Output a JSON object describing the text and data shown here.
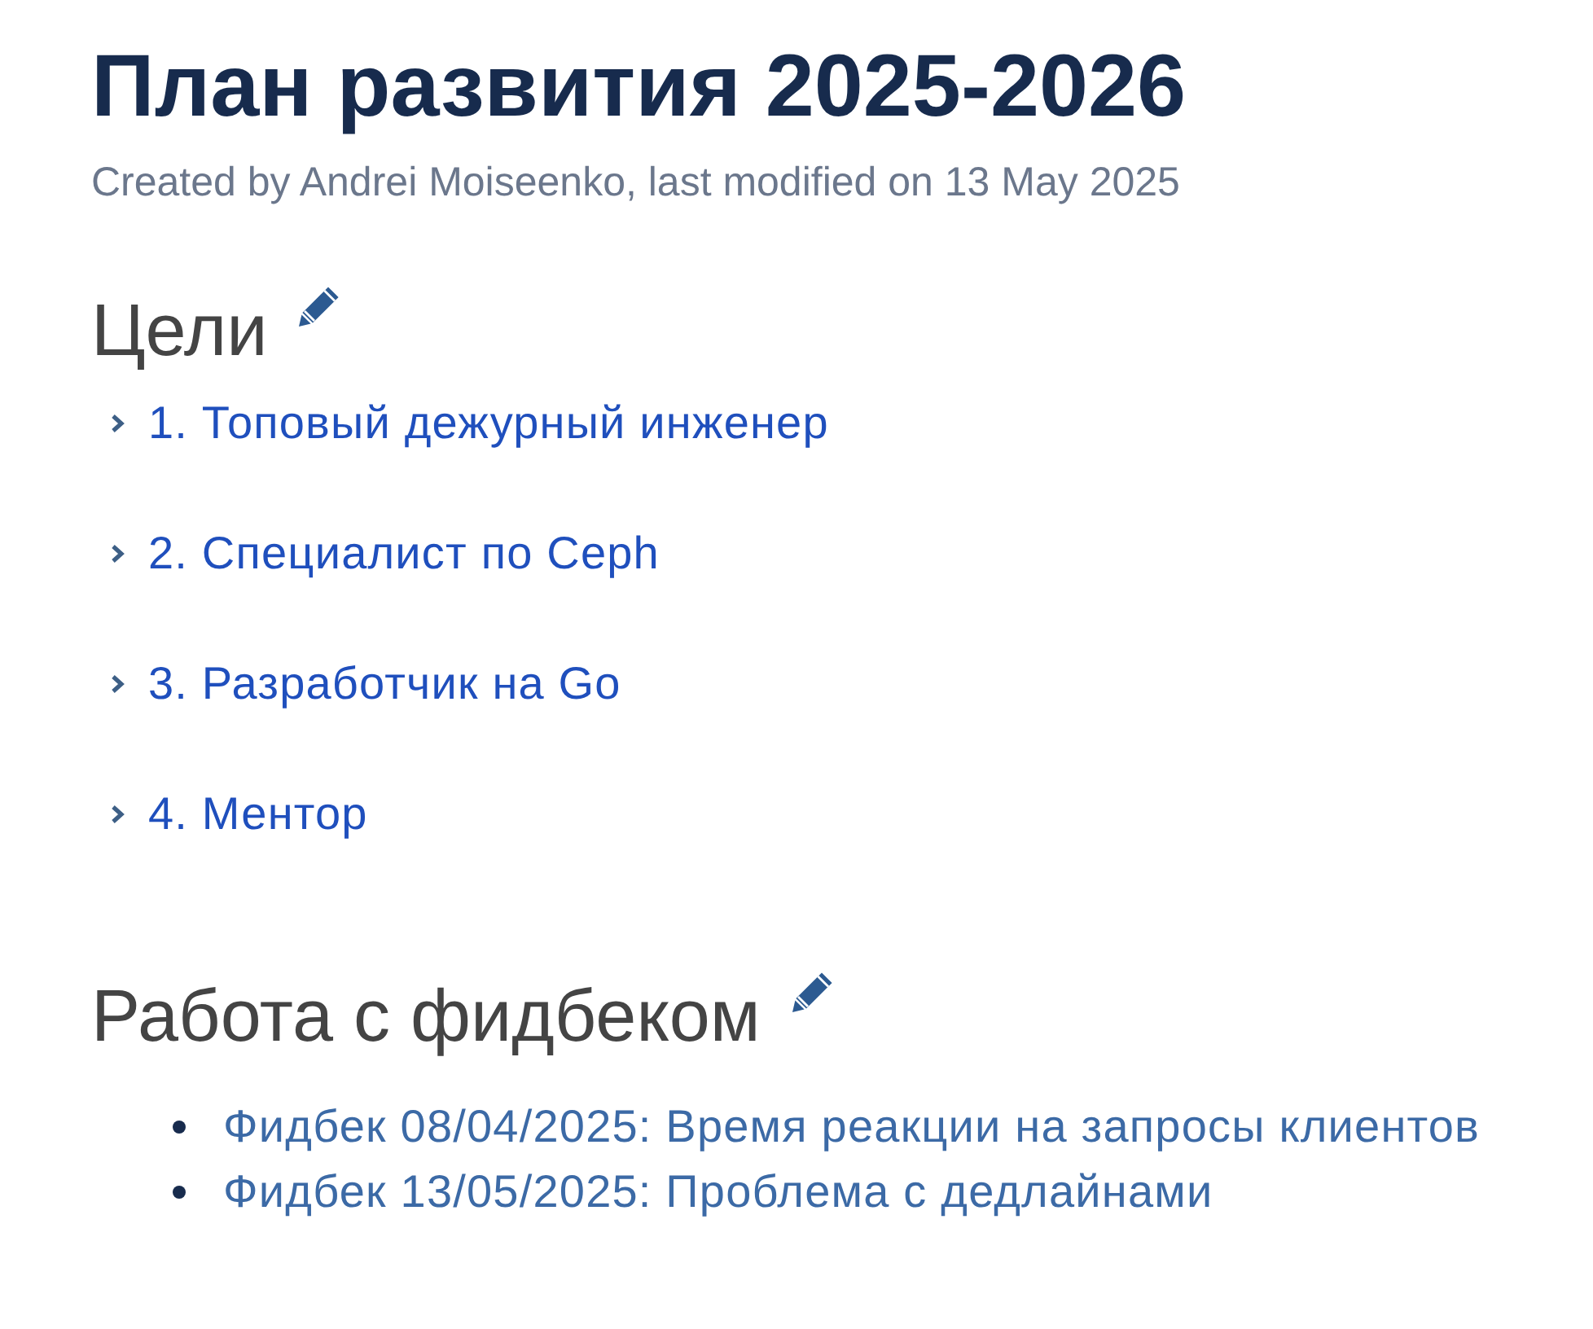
{
  "page": {
    "title": "План развития 2025-2026",
    "byline": "Created by Andrei Moiseenko, last modified on 13 May 2025"
  },
  "sections": [
    {
      "heading": "Цели",
      "kind": "expand_list",
      "items": [
        {
          "label": "1. Топовый дежурный инженер",
          "expanded": false
        },
        {
          "label": "2. Специалист по Ceph",
          "expanded": false
        },
        {
          "label": "3. Разработчик на Go",
          "expanded": false
        },
        {
          "label": "4. Ментор",
          "expanded": false
        }
      ]
    },
    {
      "heading": "Работа с фидбеком",
      "kind": "bullet_list",
      "items": [
        {
          "label": "Фидбек 08/04/2025: Время реакции на запросы клиентов"
        },
        {
          "label": "Фидбек 13/05/2025: Проблема с дедлайнами"
        }
      ]
    }
  ]
}
